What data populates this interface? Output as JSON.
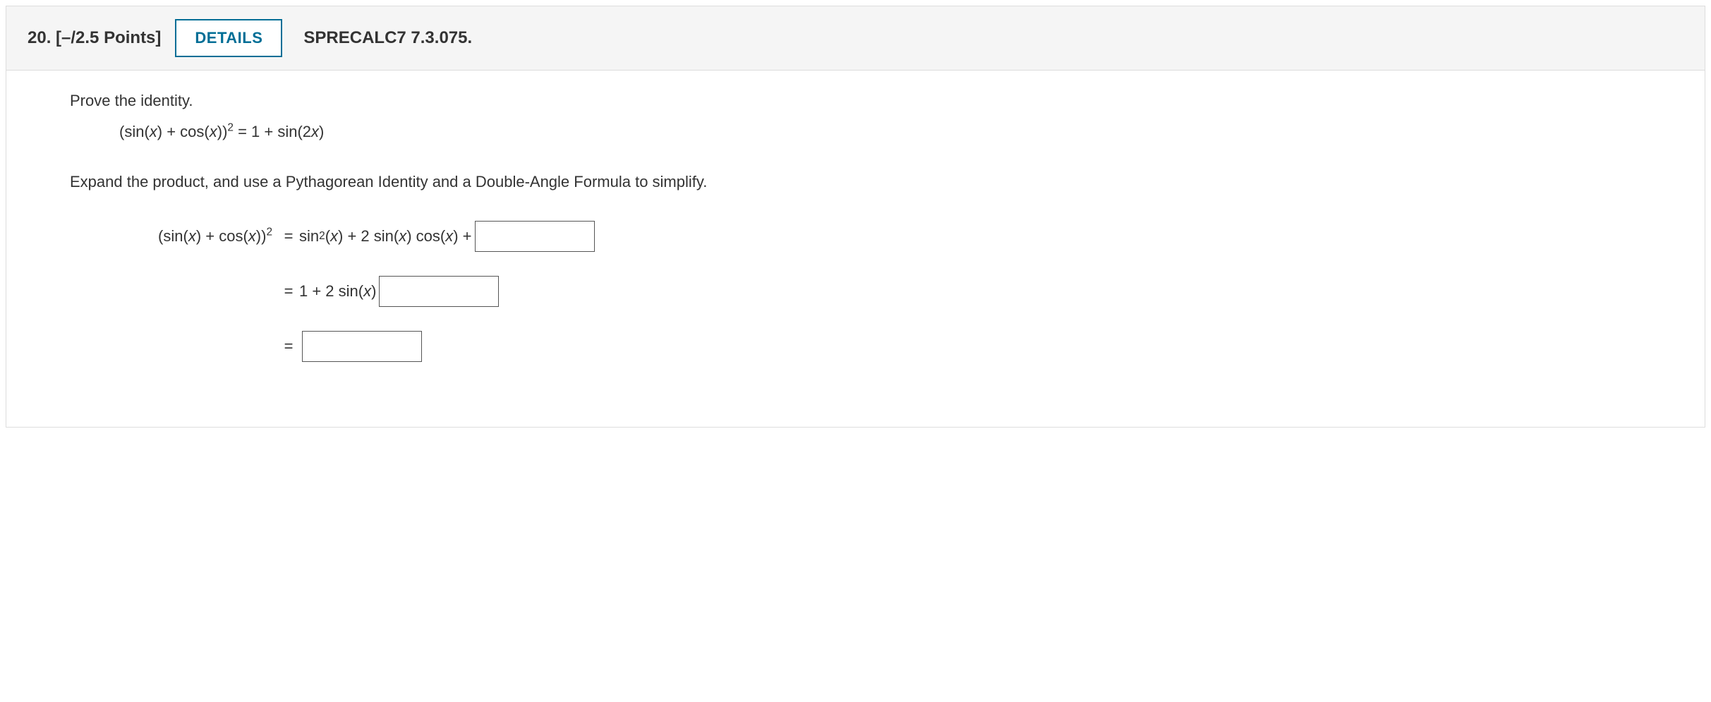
{
  "header": {
    "number_points": "20.  [–/2.5 Points]",
    "details_label": "DETAILS",
    "reference": "SPRECALC7 7.3.075."
  },
  "body": {
    "prompt": "Prove the identity.",
    "identity_lhs_a": "(sin(",
    "identity_lhs_b": ") + cos(",
    "identity_lhs_c": "))",
    "identity_rhs_a": " = 1 + sin(2",
    "identity_rhs_b": ")",
    "instructions": "Expand the product, and use a Pythagorean Identity and a Double-Angle Formula to simplify.",
    "row1_lhs_a": "(sin(",
    "row1_lhs_b": ") + cos(",
    "row1_lhs_c": "))",
    "eq": "=",
    "row1_rhs_a": "sin",
    "row1_rhs_b": "(",
    "row1_rhs_c": ") + 2 sin(",
    "row1_rhs_d": ") cos(",
    "row1_rhs_e": ") +",
    "row2_rhs_a": "1 + 2 sin(",
    "row2_rhs_b": ")",
    "var_x": "x",
    "sup2": "2",
    "inputs": {
      "a": "",
      "b": "",
      "c": ""
    }
  }
}
